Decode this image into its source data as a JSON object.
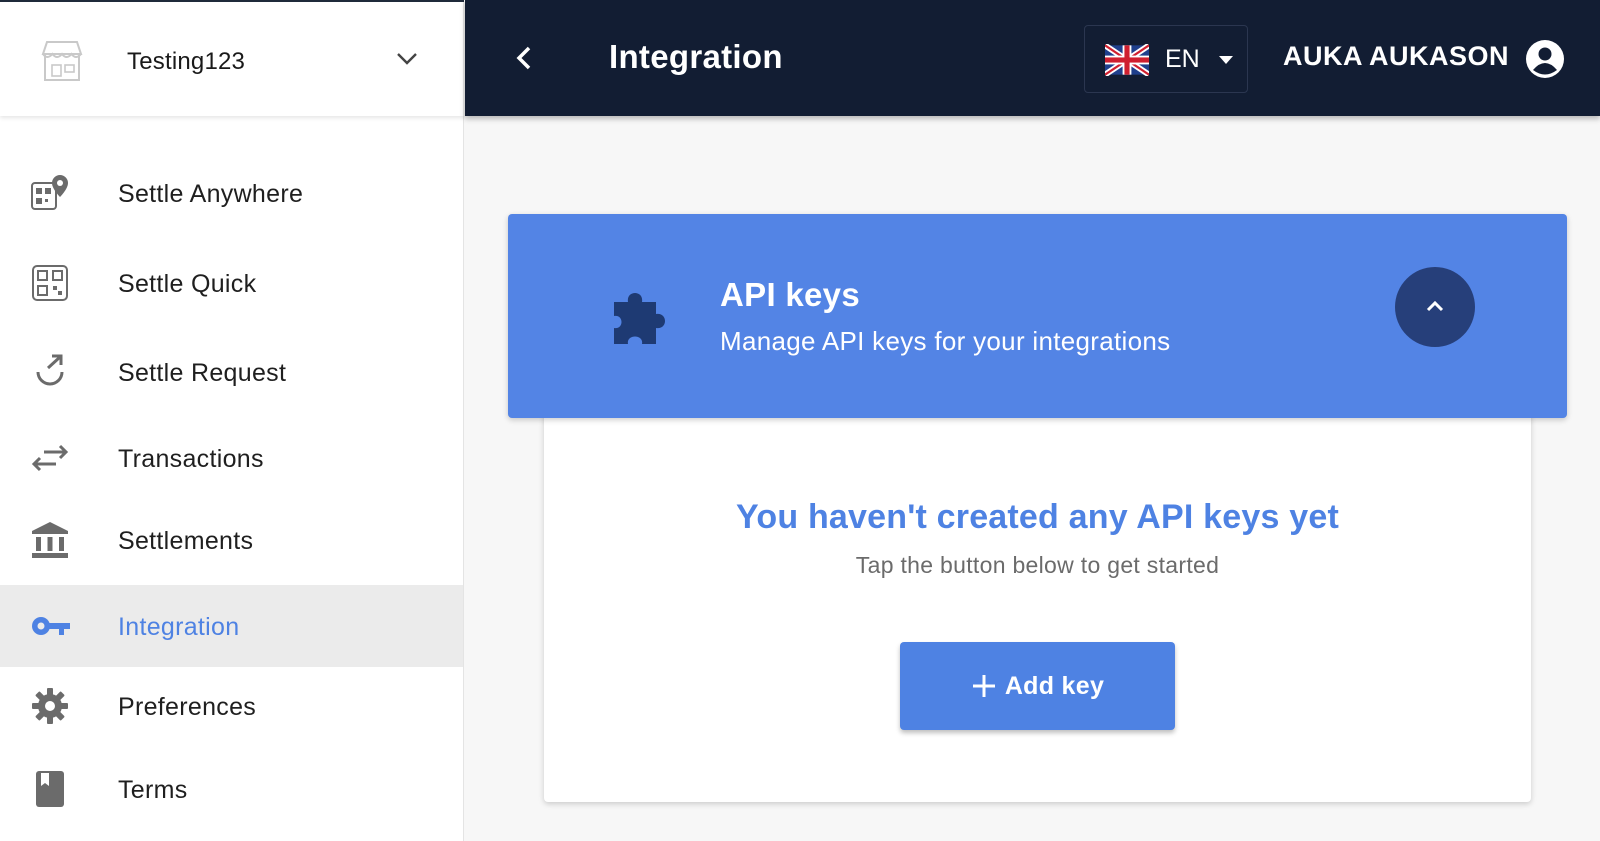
{
  "sidebar": {
    "shop": {
      "name": "Testing123",
      "icon": "storefront-icon"
    },
    "items": [
      {
        "label": "Settle Anywhere",
        "icon": "qr-location-icon",
        "active": false
      },
      {
        "label": "Settle Quick",
        "icon": "qr-code-icon",
        "active": false
      },
      {
        "label": "Settle Request",
        "icon": "request-arrow-icon",
        "active": false
      },
      {
        "label": "Transactions",
        "icon": "swap-arrows-icon",
        "active": false
      },
      {
        "label": "Settlements",
        "icon": "bank-icon",
        "active": false
      },
      {
        "label": "Integration",
        "icon": "key-icon",
        "active": true
      },
      {
        "label": "Preferences",
        "icon": "gear-icon",
        "active": false
      },
      {
        "label": "Terms",
        "icon": "book-icon",
        "active": false
      }
    ]
  },
  "topbar": {
    "title": "Integration",
    "language": {
      "code": "EN",
      "flag": "uk-flag-icon"
    },
    "user": {
      "name": "AUKA AUKASON",
      "icon": "account-circle-icon"
    }
  },
  "panel": {
    "title": "API keys",
    "subtitle": "Manage API keys for your integrations",
    "empty_title": "You haven't created any API keys yet",
    "empty_hint": "Tap the button below to get started",
    "add_button_label": "Add key"
  },
  "colors": {
    "topbar_bg": "#121d33",
    "accent": "#4e82e3",
    "panel_header_bg": "#5384e5",
    "collapse_button_bg": "#263f7a",
    "active_item_bg": "#ebebeb"
  }
}
